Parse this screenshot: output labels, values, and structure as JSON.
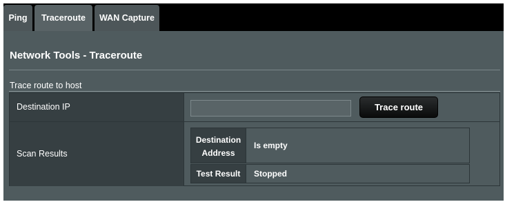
{
  "tabs": [
    {
      "label": "Ping",
      "active": false
    },
    {
      "label": "Traceroute",
      "active": true
    },
    {
      "label": "WAN Capture",
      "active": false
    }
  ],
  "page": {
    "title": "Network Tools - Traceroute",
    "section_title": "Trace route to host"
  },
  "form": {
    "destination_ip_label": "Destination IP",
    "destination_ip_value": "",
    "trace_button_label": "Trace route",
    "scan_results_label": "Scan Results"
  },
  "results": {
    "destination_address_label_line1": "Destination",
    "destination_address_label_line2": "Address",
    "destination_address_value": "Is empty",
    "test_result_label": "Test Result",
    "test_result_value": "Stopped"
  },
  "colors": {
    "background": "#4f5b5e",
    "label_cell": "#363f42",
    "tab_bar": "#000000",
    "button": "#0a0b0b"
  }
}
